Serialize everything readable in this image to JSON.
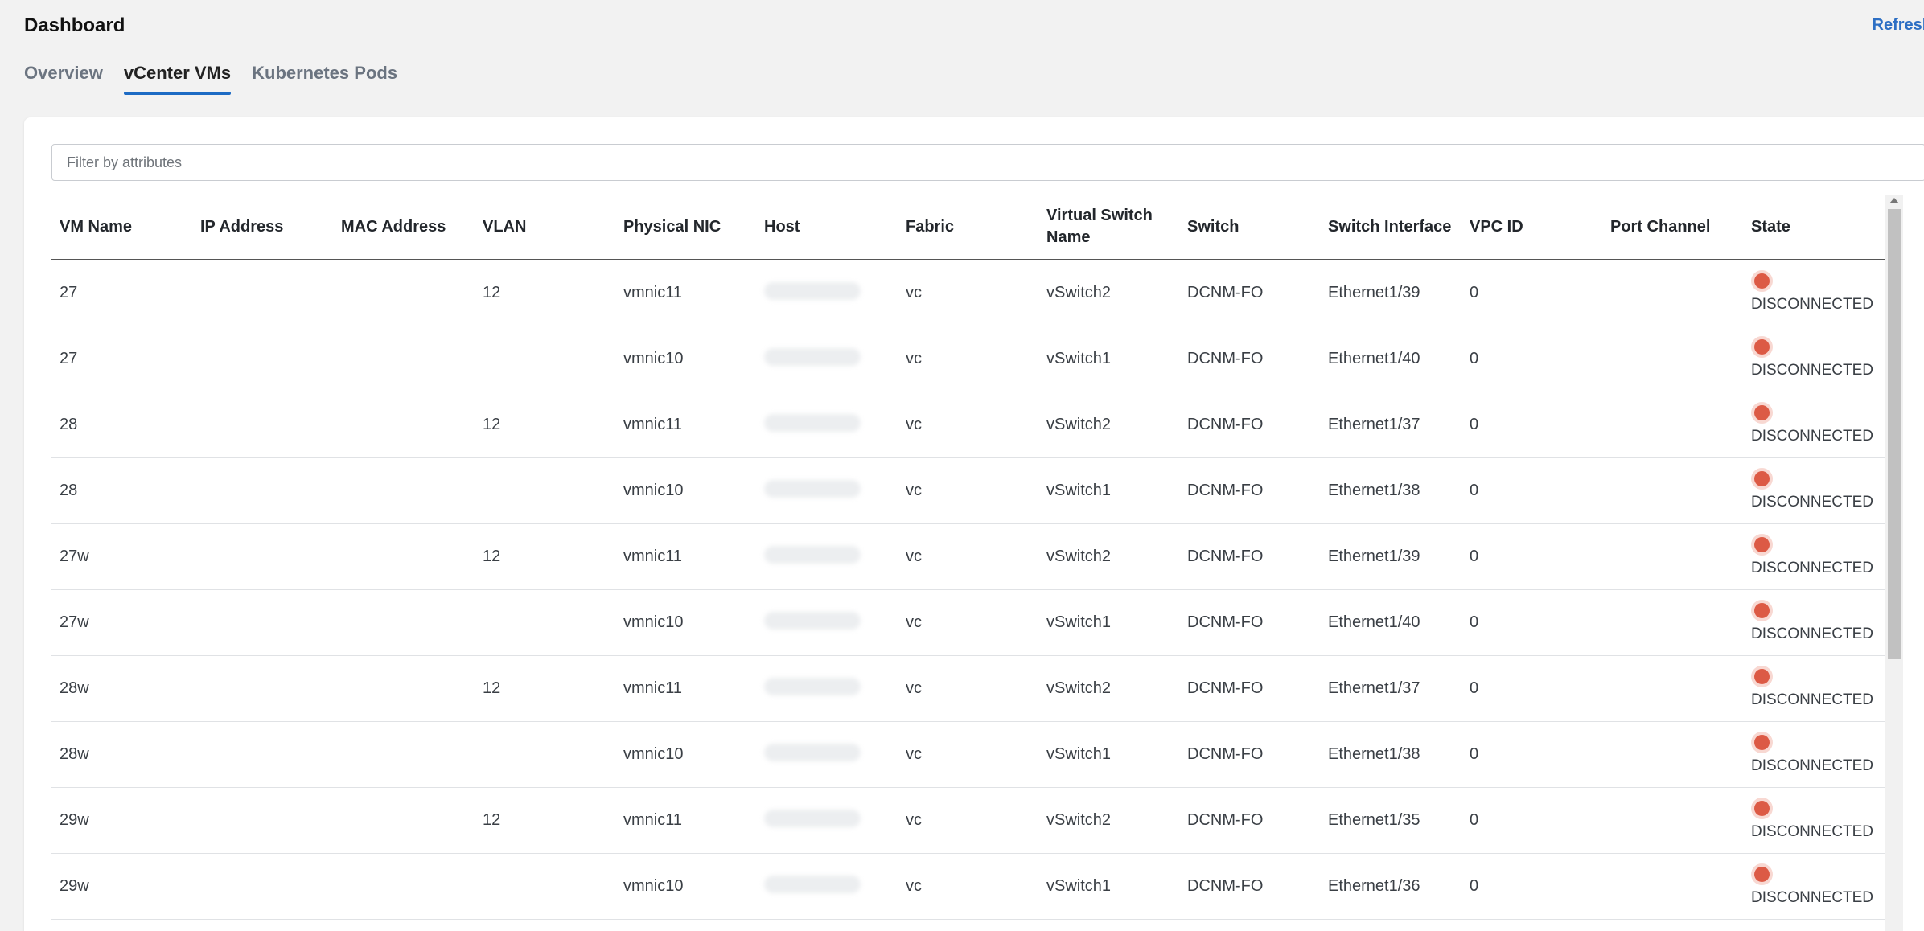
{
  "header": {
    "title": "Dashboard",
    "refresh_label": "Refresh"
  },
  "tabs": [
    {
      "label": "Overview",
      "active": false
    },
    {
      "label": "vCenter VMs",
      "active": true
    },
    {
      "label": "Kubernetes Pods",
      "active": false
    }
  ],
  "filter": {
    "placeholder": "Filter by attributes",
    "value": ""
  },
  "table": {
    "columns": [
      "VM Name",
      "IP Address",
      "MAC Address",
      "VLAN",
      "Physical NIC",
      "Host",
      "Fabric",
      "Virtual Switch Name",
      "Switch",
      "Switch Interface",
      "VPC ID",
      "Port Channel",
      "State"
    ],
    "rows": [
      {
        "vm_name": "27",
        "ip": "",
        "mac": "",
        "vlan": "12",
        "nic": "vmnic11",
        "host": "",
        "fabric": "vc",
        "vswitch": "vSwitch2",
        "switch": "DCNM-FO",
        "interface": "Ethernet1/39",
        "vpc_id": "0",
        "port_channel": "",
        "state": "DISCONNECTED"
      },
      {
        "vm_name": "27",
        "ip": "",
        "mac": "",
        "vlan": "",
        "nic": "vmnic10",
        "host": "",
        "fabric": "vc",
        "vswitch": "vSwitch1",
        "switch": "DCNM-FO",
        "interface": "Ethernet1/40",
        "vpc_id": "0",
        "port_channel": "",
        "state": "DISCONNECTED"
      },
      {
        "vm_name": "28",
        "ip": "",
        "mac": "",
        "vlan": "12",
        "nic": "vmnic11",
        "host": "",
        "fabric": "vc",
        "vswitch": "vSwitch2",
        "switch": "DCNM-FO",
        "interface": "Ethernet1/37",
        "vpc_id": "0",
        "port_channel": "",
        "state": "DISCONNECTED"
      },
      {
        "vm_name": "28",
        "ip": "",
        "mac": "",
        "vlan": "",
        "nic": "vmnic10",
        "host": "",
        "fabric": "vc",
        "vswitch": "vSwitch1",
        "switch": "DCNM-FO",
        "interface": "Ethernet1/38",
        "vpc_id": "0",
        "port_channel": "",
        "state": "DISCONNECTED"
      },
      {
        "vm_name": "27w",
        "ip": "",
        "mac": "",
        "vlan": "12",
        "nic": "vmnic11",
        "host": "",
        "fabric": "vc",
        "vswitch": "vSwitch2",
        "switch": "DCNM-FO",
        "interface": "Ethernet1/39",
        "vpc_id": "0",
        "port_channel": "",
        "state": "DISCONNECTED"
      },
      {
        "vm_name": "27w",
        "ip": "",
        "mac": "",
        "vlan": "",
        "nic": "vmnic10",
        "host": "",
        "fabric": "vc",
        "vswitch": "vSwitch1",
        "switch": "DCNM-FO",
        "interface": "Ethernet1/40",
        "vpc_id": "0",
        "port_channel": "",
        "state": "DISCONNECTED"
      },
      {
        "vm_name": "28w",
        "ip": "",
        "mac": "",
        "vlan": "12",
        "nic": "vmnic11",
        "host": "",
        "fabric": "vc",
        "vswitch": "vSwitch2",
        "switch": "DCNM-FO",
        "interface": "Ethernet1/37",
        "vpc_id": "0",
        "port_channel": "",
        "state": "DISCONNECTED"
      },
      {
        "vm_name": "28w",
        "ip": "",
        "mac": "",
        "vlan": "",
        "nic": "vmnic10",
        "host": "",
        "fabric": "vc",
        "vswitch": "vSwitch1",
        "switch": "DCNM-FO",
        "interface": "Ethernet1/38",
        "vpc_id": "0",
        "port_channel": "",
        "state": "DISCONNECTED"
      },
      {
        "vm_name": "29w",
        "ip": "",
        "mac": "",
        "vlan": "12",
        "nic": "vmnic11",
        "host": "",
        "fabric": "vc",
        "vswitch": "vSwitch2",
        "switch": "DCNM-FO",
        "interface": "Ethernet1/35",
        "vpc_id": "0",
        "port_channel": "",
        "state": "DISCONNECTED"
      },
      {
        "vm_name": "29w",
        "ip": "",
        "mac": "",
        "vlan": "",
        "nic": "vmnic10",
        "host": "",
        "fabric": "vc",
        "vswitch": "vSwitch1",
        "switch": "DCNM-FO",
        "interface": "Ethernet1/36",
        "vpc_id": "0",
        "port_channel": "",
        "state": "DISCONNECTED"
      }
    ]
  },
  "colors": {
    "accent": "#1d6bc4",
    "link": "#2d6fc4",
    "state_disconnected": "#dc5a45"
  },
  "icons": {
    "state": "status-dot-icon",
    "scroll_up": "chevron-up-icon"
  }
}
